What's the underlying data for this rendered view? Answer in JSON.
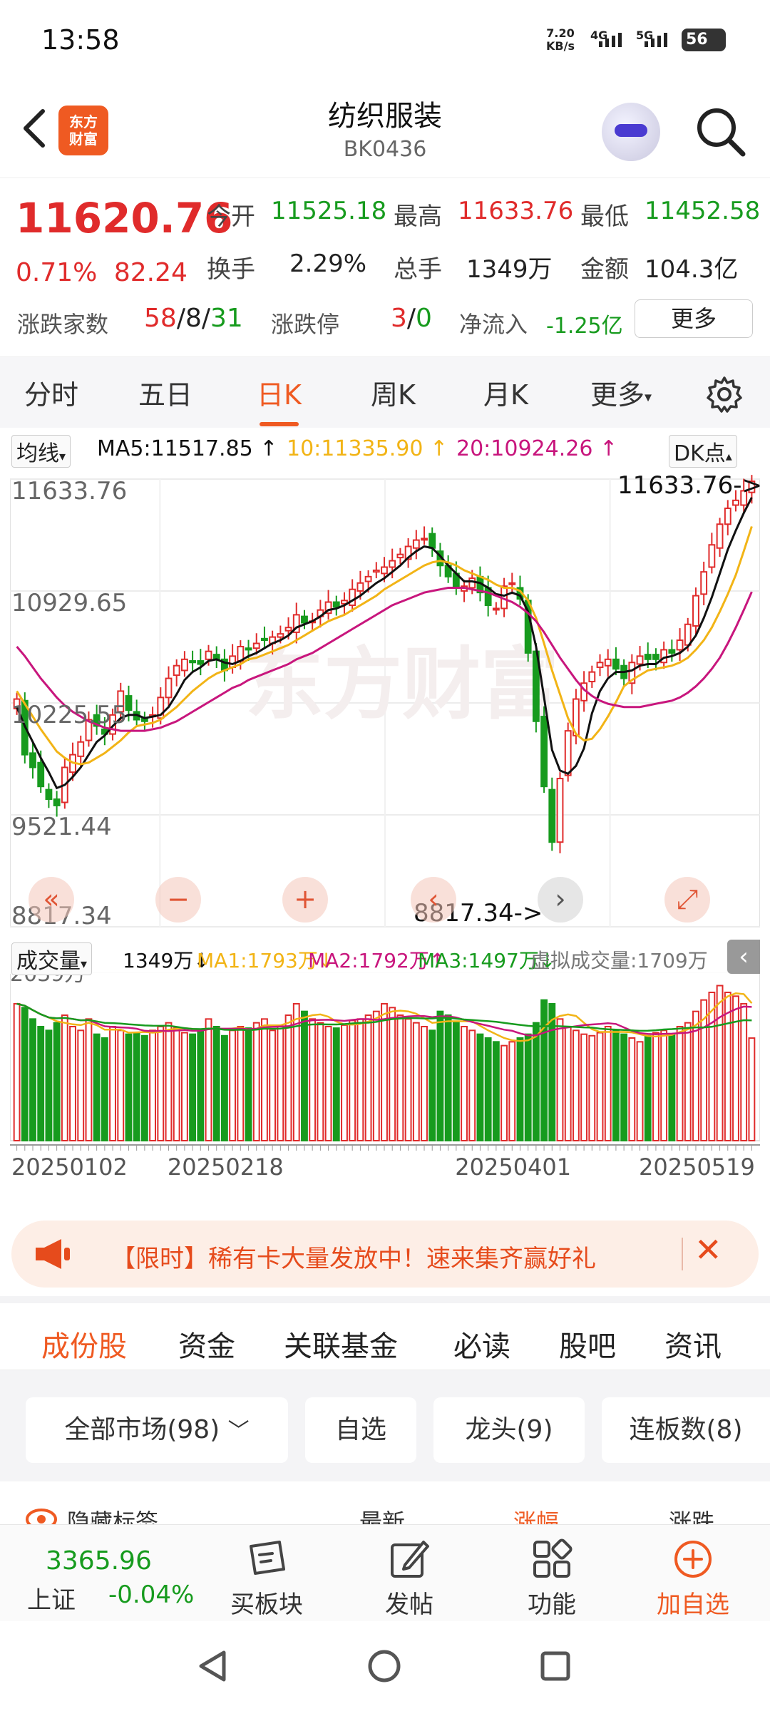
{
  "status_bar": {
    "time": "13:58",
    "net_speed": "7.20",
    "net_unit": "KB/s",
    "sig1": "4G",
    "sig2": "5G",
    "battery": "56"
  },
  "header": {
    "logo_text_1": "东方",
    "logo_text_2": "财富",
    "title": "纺织服装",
    "code": "BK0436"
  },
  "quote": {
    "price": "11620.76",
    "change_pct": "0.71%",
    "change_abs": "82.24",
    "open_label": "今开",
    "open": "11525.18",
    "high_label": "最高",
    "high": "11633.76",
    "low_label": "最低",
    "low": "11452.58",
    "turnover_label": "换手",
    "turnover": "2.29%",
    "volume_label": "总手",
    "volume": "1349万",
    "amount_label": "金额",
    "amount": "104.3亿",
    "breadth_label": "涨跌家数",
    "up": "58",
    "flat": "8",
    "down": "31",
    "limit_label": "涨跌停",
    "limit_up": "3",
    "limit_down": "0",
    "inflow_label": "净流入",
    "inflow": "-1.25亿",
    "more_button": "更多"
  },
  "kline_tabs": [
    "分时",
    "五日",
    "日K",
    "周K",
    "月K",
    "更多"
  ],
  "active_tab": "日K",
  "ma_bar": {
    "selector": "均线",
    "ma5": "MA5:11517.85 ↑",
    "ma10": "10:11335.90 ↑",
    "ma20": "20:10924.26 ↑",
    "dk": "DK点"
  },
  "vol_bar": {
    "selector": "成交量",
    "vol": "1349万↓",
    "ma1": "MA1:1793万↓",
    "ma2": "MA2:1792万↑",
    "ma3": "MA3:1497万↓",
    "virtual": "虚拟成交量:1709万"
  },
  "chart_data": {
    "type": "candlestick",
    "price_axis_labels": [
      "11633.76",
      "10929.65",
      "10225.55",
      "9521.44",
      "8817.34"
    ],
    "ylim": [
      8817.34,
      11633.76
    ],
    "max_marker": "11633.76->",
    "min_marker": "8817.34->",
    "volume_axis_label": "2039万",
    "dates": [
      "20250102",
      "20250218",
      "20250401",
      "20250519"
    ],
    "watermark": "东方财富",
    "closes": [
      10250,
      9900,
      9820,
      9700,
      9620,
      9580,
      9820,
      9900,
      9980,
      10120,
      10080,
      10030,
      10150,
      10300,
      10180,
      10120,
      10110,
      10150,
      10260,
      10380,
      10460,
      10500,
      10480,
      10470,
      10550,
      10500,
      10430,
      10520,
      10580,
      10560,
      10600,
      10620,
      10640,
      10660,
      10700,
      10780,
      10730,
      10740,
      10810,
      10860,
      10830,
      10870,
      10940,
      10980,
      11020,
      11060,
      11080,
      11120,
      11160,
      11210,
      11250,
      11260,
      11200,
      11090,
      11020,
      10960,
      10960,
      11010,
      10920,
      10840,
      10820,
      10960,
      10980,
      10880,
      10540,
      10110,
      9700,
      9350,
      9750,
      10050,
      10250,
      10350,
      10420,
      10480,
      10500,
      10440,
      10380,
      10480,
      10520,
      10500,
      10500,
      10560,
      10540,
      10620,
      10720,
      10900,
      11050,
      11220,
      11350,
      11450,
      11500,
      11560,
      11620
    ],
    "ma5": [
      10200,
      10080,
      9980,
      9880,
      9790,
      9690,
      9710,
      9760,
      9820,
      9900,
      9980,
      10020,
      10080,
      10130,
      10150,
      10150,
      10130,
      10140,
      10150,
      10200,
      10280,
      10370,
      10420,
      10450,
      10490,
      10500,
      10480,
      10470,
      10490,
      10520,
      10540,
      10570,
      10600,
      10620,
      10650,
      10700,
      10720,
      10740,
      10770,
      10810,
      10820,
      10840,
      10870,
      10900,
      10940,
      10980,
      11010,
      11050,
      11090,
      11140,
      11180,
      11210,
      11200,
      11150,
      11090,
      11040,
      10990,
      10990,
      10980,
      10950,
      10910,
      10900,
      10920,
      10900,
      10800,
      10580,
      10260,
      9930,
      9800,
      9780,
      9830,
      9940,
      10160,
      10300,
      10380,
      10420,
      10420,
      10430,
      10460,
      10470,
      10470,
      10510,
      10520,
      10540,
      10580,
      10650,
      10760,
      10890,
      11040,
      11190,
      11310,
      11420,
      11517.85
    ],
    "ma10": [
      10300,
      10220,
      10140,
      10060,
      9990,
      9920,
      9880,
      9850,
      9840,
      9850,
      9880,
      9910,
      9950,
      9990,
      10040,
      10080,
      10090,
      10100,
      10120,
      10160,
      10200,
      10250,
      10300,
      10340,
      10380,
      10410,
      10430,
      10450,
      10470,
      10500,
      10510,
      10530,
      10550,
      10570,
      10590,
      10620,
      10650,
      10680,
      10710,
      10740,
      10760,
      10780,
      10810,
      10840,
      10870,
      10900,
      10940,
      10970,
      11000,
      11030,
      11060,
      11090,
      11110,
      11120,
      11110,
      11090,
      11060,
      11040,
      11020,
      11000,
      10970,
      10950,
      10950,
      10930,
      10870,
      10760,
      10600,
      10430,
      10280,
      10130,
      10030,
      9990,
      10000,
      10060,
      10140,
      10230,
      10330,
      10370,
      10400,
      10430,
      10440,
      10450,
      10460,
      10480,
      10510,
      10560,
      10620,
      10700,
      10800,
      10910,
      11030,
      11180,
      11335.9
    ],
    "ma20": [
      10580,
      10520,
      10450,
      10380,
      10320,
      10260,
      10210,
      10170,
      10140,
      10110,
      10090,
      10070,
      10060,
      10050,
      10050,
      10050,
      10050,
      10060,
      10070,
      10090,
      10110,
      10140,
      10170,
      10200,
      10230,
      10260,
      10290,
      10320,
      10340,
      10370,
      10390,
      10410,
      10430,
      10450,
      10470,
      10500,
      10520,
      10540,
      10570,
      10600,
      10630,
      10660,
      10690,
      10720,
      10750,
      10780,
      10810,
      10840,
      10860,
      10880,
      10900,
      10920,
      10930,
      10940,
      10950,
      10950,
      10950,
      10940,
      10930,
      10920,
      10900,
      10880,
      10860,
      10830,
      10790,
      10740,
      10670,
      10590,
      10510,
      10440,
      10370,
      10310,
      10270,
      10240,
      10220,
      10210,
      10200,
      10200,
      10200,
      10210,
      10220,
      10230,
      10240,
      10260,
      10290,
      10330,
      10380,
      10440,
      10510,
      10600,
      10700,
      10810,
      10924.26
    ],
    "volumes": [
      1800,
      1750,
      1600,
      1500,
      1450,
      1550,
      1650,
      1500,
      1450,
      1600,
      1400,
      1350,
      1500,
      1450,
      1400,
      1420,
      1380,
      1450,
      1500,
      1550,
      1480,
      1420,
      1400,
      1450,
      1600,
      1500,
      1380,
      1450,
      1500,
      1480,
      1550,
      1600,
      1450,
      1500,
      1650,
      1800,
      1700,
      1600,
      1550,
      1500,
      1480,
      1520,
      1580,
      1600,
      1650,
      1700,
      1800,
      1750,
      1650,
      1600,
      1550,
      1500,
      1450,
      1700,
      1650,
      1550,
      1500,
      1450,
      1400,
      1350,
      1300,
      1250,
      1300,
      1350,
      1400,
      1550,
      1850,
      1800,
      1600,
      1500,
      1450,
      1400,
      1380,
      1420,
      1500,
      1450,
      1400,
      1350,
      1300,
      1380,
      1420,
      1450,
      1400,
      1500,
      1550,
      1700,
      1850,
      1950,
      2039,
      1950,
      1900,
      1800,
      1349
    ]
  },
  "zoom_controls": [
    "«",
    "−",
    "+",
    "‹",
    "›",
    "⤢"
  ],
  "banner": {
    "text": "【限时】稀有卡大量发放中！速来集齐赢好礼"
  },
  "section_tabs": [
    "成份股",
    "资金",
    "关联基金",
    "必读",
    "股吧",
    "资讯"
  ],
  "filters": [
    "全部市场(98)",
    "自选",
    "龙头(9)",
    "连板数(8)"
  ],
  "list_header": [
    "隐藏标签",
    "最新",
    "涨幅",
    "涨跌"
  ],
  "bottom_bar": {
    "index_value": "3365.96",
    "index_name": "上证",
    "index_change": "-0.04%",
    "buy": "买板块",
    "post": "发帖",
    "func": "功能",
    "add": "加自选"
  },
  "colors": {
    "up": "#e02b2b",
    "down": "#179b1e",
    "ma5": "#111111",
    "ma10": "#f2b416",
    "ma20": "#c8167d",
    "accent": "#ef5a22"
  }
}
